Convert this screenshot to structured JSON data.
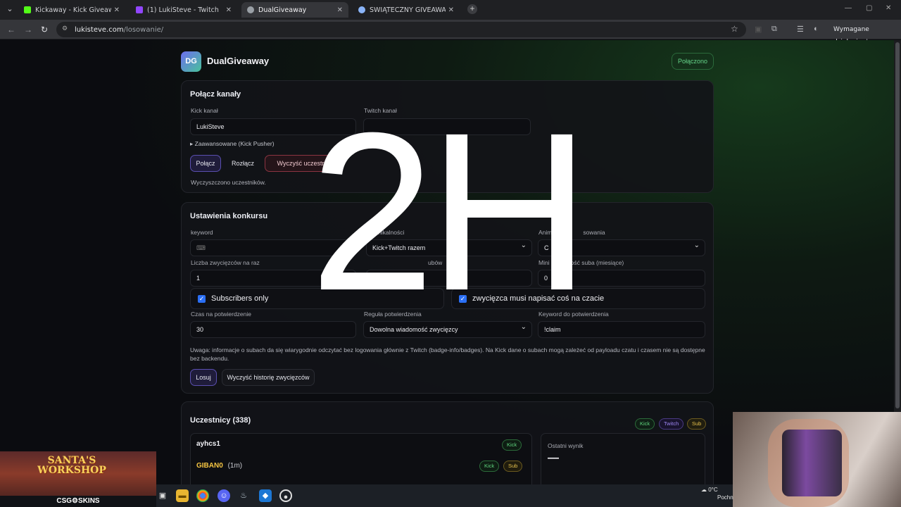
{
  "browser": {
    "tabs": [
      {
        "title": "Kickaway - Kick Giveaway Tool",
        "favicon_color": "#53fc18",
        "active": false
      },
      {
        "title": "(1) LukiSteve - Twitch",
        "favicon_color": "#9146ff",
        "active": false
      },
      {
        "title": "DualGiveaway",
        "favicon_color": "#9aa0a6",
        "active": true
      },
      {
        "title": "ŚWIĄTECZNY GIVEAWAY",
        "favicon_color": "#8ab4f8",
        "active": false
      }
    ],
    "url_host": "lukisteve.com",
    "url_path": "/losowanie/",
    "action_required": "Wymagane działanie"
  },
  "app": {
    "logo": "DG",
    "name": "DualGiveaway",
    "status": "Połączono",
    "accent_color": "#66d58a"
  },
  "connect": {
    "title": "Połącz kanały",
    "kick_label": "Kick kanał",
    "kick_value": "LukiSteve",
    "twitch_label": "Twitch kanał",
    "advanced": "▸ Zaawansowane (Kick Pusher)",
    "connect_btn": "Połącz",
    "disconnect_btn": "Rozłącz",
    "clear_btn": "Wyczyść uczestn",
    "message": "Wyczyszczono uczestników."
  },
  "settings": {
    "title": "Ustawienia konkursu",
    "keyword_label": "keyword",
    "keyword_value": "",
    "uniq_label": "yb unikalności",
    "uniq_value": "Kick+Twitch razem",
    "anim_label": "Anim",
    "anim_label2": "sowania",
    "anim_value": "C",
    "winners_label": "Liczba zwycięzców na raz",
    "winners_value": "1",
    "subs_label": "ubów",
    "min_sub_label": "Mini",
    "min_sub_label2": "długość suba (miesiące)",
    "min_sub_value": "0",
    "subs_only": "Subscribers only",
    "must_chat": "zwycięzca musi napisać coś na czacie",
    "confirm_time_label": "Czas na potwierdzenie",
    "confirm_time_value": "30",
    "confirm_rule_label": "Reguła potwierdzenia",
    "confirm_rule_value": "Dowolna wiadomość zwycięzcy",
    "confirm_keyword_label": "Keyword do potwierdzenia",
    "confirm_keyword_value": "!claim",
    "note": "Uwaga: informacje o subach da się wiarygodnie odczytać bez logowania głównie z Twitch (badge-info/badges). Na Kick dane o subach mogą zależeć od payloadu czatu i czasem nie są dostępne bez backendu.",
    "draw_btn": "Losuj",
    "clear_history_btn": "Wyczyść historię zwycięzców"
  },
  "participants": {
    "title": "Uczestnicy (338)",
    "filters": [
      "Kick",
      "Twitch",
      "Sub"
    ],
    "items": [
      {
        "name": "ayhcs1",
        "extra": "",
        "tags": [
          "Kick"
        ],
        "color": "#f2f2f6"
      },
      {
        "name": "GIBAN0",
        "extra": "(1m)",
        "tags": [
          "Kick",
          "Sub"
        ],
        "color": "#f5c542"
      }
    ],
    "last_result_label": "Ostatni wynik",
    "last_result_value": "—"
  },
  "overlay_text": "2H",
  "promo": {
    "title": "SANTA'S WORKSHOP",
    "brand": "CSG⚙SKINS"
  },
  "tray": {
    "temp": "0°C",
    "weather": "Pochn"
  },
  "icons": {
    "taskbar": [
      "folder-icon",
      "chrome-icon",
      "discord-icon",
      "steam-icon",
      "app-icon",
      "obs-icon"
    ]
  }
}
